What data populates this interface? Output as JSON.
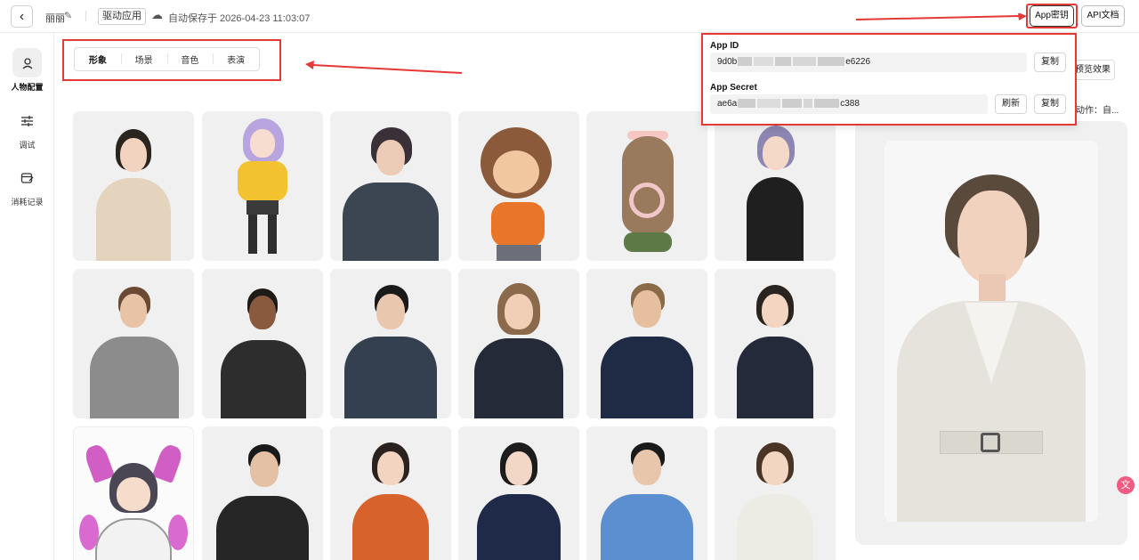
{
  "header": {
    "back_icon": "chevron-left-icon",
    "app_name": "丽丽",
    "edit_icon": "pencil-icon",
    "app_tag": "驱动应用",
    "cloud_icon": "cloud-icon",
    "autosave_text": "自动保存于 2026-04-23 11:03:07",
    "app_key_button": "App密钥",
    "api_doc_button": "API文档"
  },
  "sidebar": {
    "items": [
      {
        "label": "人物配置",
        "icon": "person-icon",
        "active": true
      },
      {
        "label": "调试",
        "icon": "sliders-icon",
        "active": false
      },
      {
        "label": "消耗记录",
        "icon": "receipt-icon",
        "active": false
      }
    ]
  },
  "tabs": [
    {
      "label": "形象",
      "active": true
    },
    {
      "label": "场景",
      "active": false
    },
    {
      "label": "音色",
      "active": false
    },
    {
      "label": "表演",
      "active": false
    }
  ],
  "right": {
    "preview_button": "预览效果",
    "action_text": "动作：自..."
  },
  "credentials_popup": {
    "app_id_label": "App ID",
    "app_id_prefix": "9d0b",
    "app_id_suffix": "e6226",
    "app_secret_label": "App Secret",
    "app_secret_prefix": "ae6a",
    "app_secret_suffix": "c388",
    "copy_label": "复制",
    "refresh_label": "刷新"
  },
  "annotation_color": "#e53935"
}
